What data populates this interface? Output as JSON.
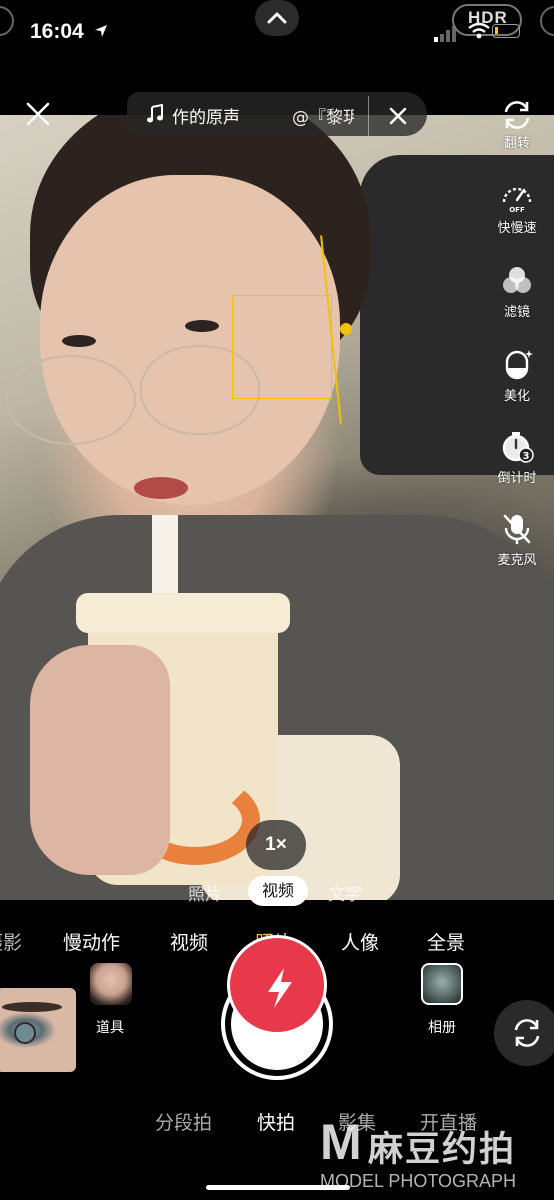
{
  "status_bar": {
    "time": "16:04",
    "hdr": "HDR"
  },
  "music": {
    "title": "作的原声",
    "artist": "@『黎玥"
  },
  "right_tools": [
    {
      "label": "翻转",
      "icon": "flip-camera-icon"
    },
    {
      "label": "快慢速",
      "icon": "speed-dial-icon",
      "badge": "OFF"
    },
    {
      "label": "滤镜",
      "icon": "filter-circles-icon"
    },
    {
      "label": "美化",
      "icon": "beautify-face-icon"
    },
    {
      "label": "倒计时",
      "icon": "countdown-timer-icon",
      "badge": "3"
    },
    {
      "label": "麦克风",
      "icon": "microphone-off-icon"
    }
  ],
  "zoom": {
    "label": "1×"
  },
  "sub_modes": {
    "photo": "照片",
    "video": "视频",
    "text": "文字"
  },
  "modes": [
    "摄影",
    "慢动作",
    "视频",
    "照片",
    "人像",
    "全景"
  ],
  "selected_mode": "照片",
  "bottom": {
    "props_label": "道具",
    "album_label": "相册"
  },
  "bottom_tabs": [
    "分段拍",
    "快拍",
    "影集",
    "开直播"
  ],
  "active_tab": "快拍",
  "watermark": {
    "mark": "M",
    "cn": "麻豆约拍",
    "en": "MODEL PHOTOGRAPH"
  },
  "colors": {
    "shutter_red": "#e8384b",
    "focus_yellow": "#f2c200",
    "selected_mode": "#e0c34d"
  }
}
